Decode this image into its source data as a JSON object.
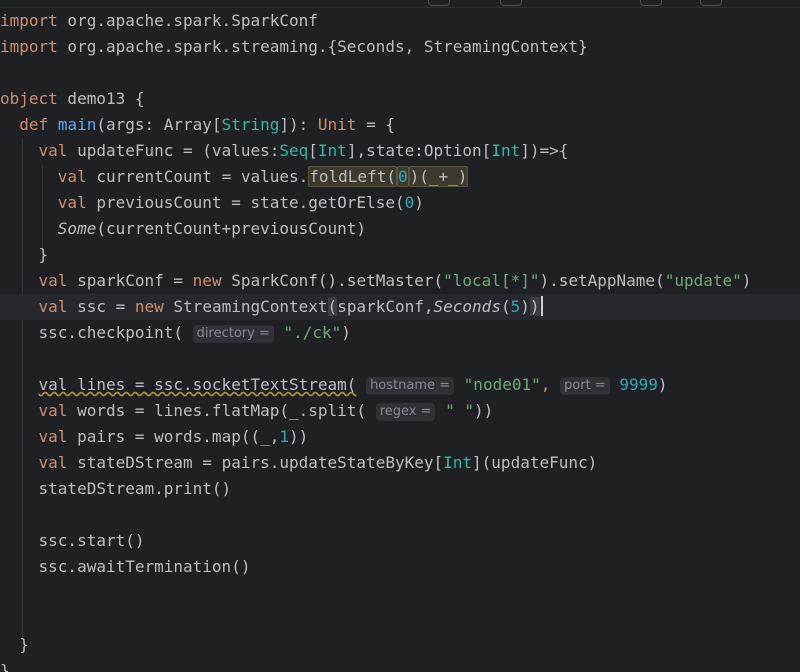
{
  "editor": {
    "lines": [
      {
        "id": 1,
        "tokens": [
          {
            "t": "import",
            "c": "kw"
          },
          {
            "t": " org.apache.spark.SparkConf"
          }
        ]
      },
      {
        "id": 2,
        "tokens": [
          {
            "t": "import",
            "c": "kw"
          },
          {
            "t": " org.apache.spark.streaming.{Seconds, StreamingContext}"
          }
        ]
      },
      {
        "id": 3,
        "tokens": []
      },
      {
        "id": 4,
        "tokens": [
          {
            "t": "object",
            "c": "kw"
          },
          {
            "t": " demo13 {"
          }
        ]
      },
      {
        "id": 5,
        "tokens": [
          {
            "t": "  "
          },
          {
            "t": "def",
            "c": "kw"
          },
          {
            "t": " "
          },
          {
            "t": "main",
            "c": "fn"
          },
          {
            "t": "(args: Array["
          },
          {
            "t": "String",
            "c": "ty"
          },
          {
            "t": "]): "
          },
          {
            "t": "Unit",
            "c": "kw"
          },
          {
            "t": " = {"
          }
        ]
      },
      {
        "id": 6,
        "tokens": [
          {
            "t": "    "
          },
          {
            "t": "val",
            "c": "kw"
          },
          {
            "t": " updateFunc = (values:"
          },
          {
            "t": "Seq",
            "c": "ty"
          },
          {
            "t": "["
          },
          {
            "t": "Int",
            "c": "ty"
          },
          {
            "t": "],state:Option["
          },
          {
            "t": "Int",
            "c": "ty"
          },
          {
            "t": "])=>{"
          }
        ]
      },
      {
        "id": 7,
        "tokens": [
          {
            "t": "      "
          },
          {
            "t": "val",
            "c": "kw"
          },
          {
            "t": " currentCount = values."
          },
          {
            "t": "foldLeft(",
            "c": "hl"
          },
          {
            "t": "0",
            "c": "num hl"
          },
          {
            "t": ")(_+_)",
            "c": "hl"
          }
        ]
      },
      {
        "id": 8,
        "tokens": [
          {
            "t": "      "
          },
          {
            "t": "val",
            "c": "kw"
          },
          {
            "t": " previousCount = state.getOrElse("
          },
          {
            "t": "0",
            "c": "num"
          },
          {
            "t": ")"
          }
        ]
      },
      {
        "id": 9,
        "tokens": [
          {
            "t": "      "
          },
          {
            "t": "Some",
            "c": "it"
          },
          {
            "t": "(currentCount+previousCount)"
          }
        ]
      },
      {
        "id": 10,
        "tokens": [
          {
            "t": "    }"
          }
        ]
      },
      {
        "id": 11,
        "tokens": [
          {
            "t": "    "
          },
          {
            "t": "val",
            "c": "kw"
          },
          {
            "t": " sparkConf = "
          },
          {
            "t": "new",
            "c": "kw"
          },
          {
            "t": " SparkConf().setMaster("
          },
          {
            "t": "\"local[*]\"",
            "c": "str"
          },
          {
            "t": ").setAppName("
          },
          {
            "t": "\"update\"",
            "c": "str"
          },
          {
            "t": ")"
          }
        ]
      },
      {
        "id": 12,
        "current": true,
        "tokens": [
          {
            "t": "    "
          },
          {
            "t": "val",
            "c": "kw"
          },
          {
            "t": " ssc = "
          },
          {
            "t": "new",
            "c": "kw"
          },
          {
            "t": " StreamingContext"
          },
          {
            "t": "(",
            "c": "sel"
          },
          {
            "t": "sparkConf,"
          },
          {
            "t": "Seconds",
            "c": "it"
          },
          {
            "t": "("
          },
          {
            "t": "5",
            "c": "num"
          },
          {
            "t": ")"
          },
          {
            "t": ")",
            "c": "sel"
          },
          {
            "t": "",
            "c": "cursor"
          }
        ]
      },
      {
        "id": 13,
        "tokens": [
          {
            "t": "    ssc.checkpoint( "
          },
          {
            "t": "directory =",
            "c": "hint"
          },
          {
            "t": " "
          },
          {
            "t": "\"./ck\"",
            "c": "str"
          },
          {
            "t": ")"
          }
        ]
      },
      {
        "id": 14,
        "tokens": []
      },
      {
        "id": 15,
        "tokens": [
          {
            "t": "    "
          },
          {
            "t": "val lines = ssc.socketTextStream(",
            "c": "warn"
          },
          {
            "t": " "
          },
          {
            "t": "hostname =",
            "c": "hint"
          },
          {
            "t": " "
          },
          {
            "t": "\"node01\"",
            "c": "str"
          },
          {
            "t": ",",
            "c": "kw"
          },
          {
            "t": " "
          },
          {
            "t": "port =",
            "c": "hint"
          },
          {
            "t": " "
          },
          {
            "t": "9999",
            "c": "num"
          },
          {
            "t": ")"
          }
        ]
      },
      {
        "id": 16,
        "tokens": [
          {
            "t": "    "
          },
          {
            "t": "val",
            "c": "kw"
          },
          {
            "t": " words = lines.flatMap(_.split( "
          },
          {
            "t": "regex =",
            "c": "hint"
          },
          {
            "t": " "
          },
          {
            "t": "\" \"",
            "c": "str"
          },
          {
            "t": "))"
          }
        ]
      },
      {
        "id": 17,
        "tokens": [
          {
            "t": "    "
          },
          {
            "t": "val",
            "c": "kw"
          },
          {
            "t": " pairs = words.map((_,"
          },
          {
            "t": "1",
            "c": "num"
          },
          {
            "t": "))"
          }
        ]
      },
      {
        "id": 18,
        "tokens": [
          {
            "t": "    "
          },
          {
            "t": "val",
            "c": "kw"
          },
          {
            "t": " stateDStream = pairs.updateStateByKey["
          },
          {
            "t": "Int",
            "c": "ty"
          },
          {
            "t": "](updateFunc)"
          }
        ]
      },
      {
        "id": 19,
        "tokens": [
          {
            "t": "    stateDStream.print()"
          }
        ]
      },
      {
        "id": 20,
        "tokens": []
      },
      {
        "id": 21,
        "tokens": [
          {
            "t": "    ssc.start()"
          }
        ]
      },
      {
        "id": 22,
        "tokens": [
          {
            "t": "    ssc.awaitTermination()"
          }
        ]
      },
      {
        "id": 23,
        "tokens": []
      },
      {
        "id": 24,
        "tokens": []
      },
      {
        "id": 25,
        "tokens": [
          {
            "t": "  }"
          }
        ]
      },
      {
        "id": 26,
        "tokens": [
          {
            "t": "}"
          }
        ]
      }
    ]
  }
}
